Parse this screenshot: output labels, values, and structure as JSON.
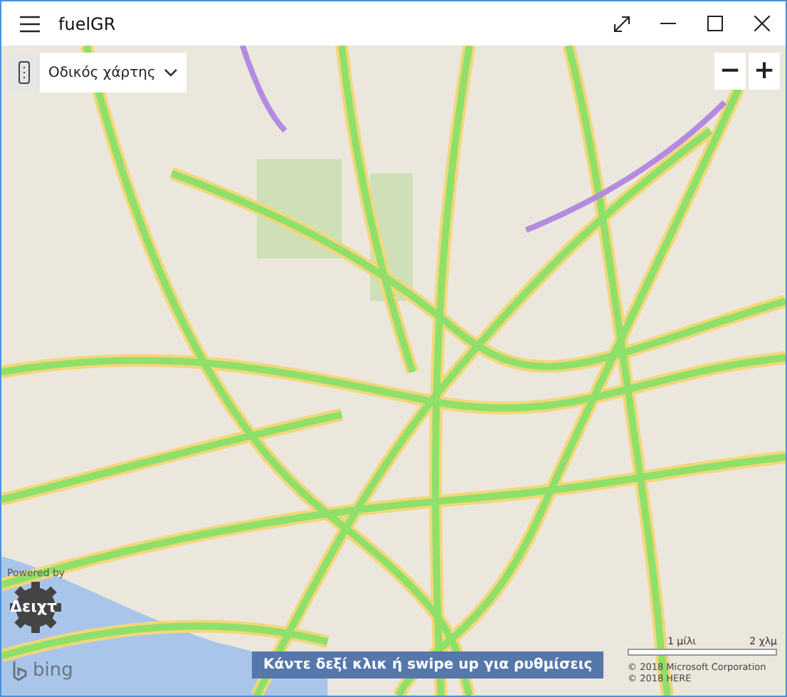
{
  "window": {
    "title": "fuelGR"
  },
  "map_controls": {
    "map_type": "Οδικός χάρτης",
    "zoom_out": "−",
    "zoom_in": "+"
  },
  "attribution": {
    "powered_by": "Powered by",
    "logo_text": "Δειχτ",
    "bing": "bing",
    "copyright": [
      "© 2018 Microsoft Corporation",
      "© 2018 HERE"
    ]
  },
  "scale": {
    "miles": "1 μίλι",
    "km": "2 χλμ"
  },
  "hint_banner": "Κάντε δεξί κλικ ή swipe up για ρυθμίσεις"
}
